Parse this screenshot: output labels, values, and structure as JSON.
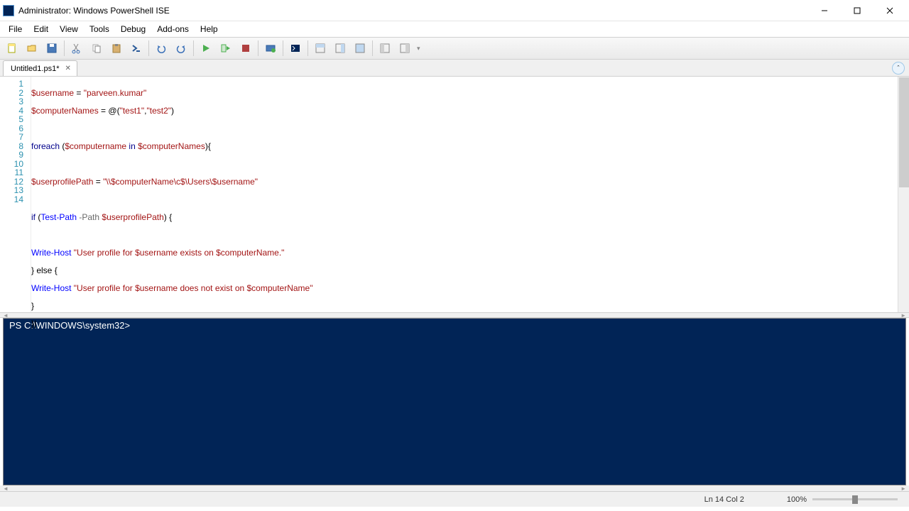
{
  "window": {
    "title": "Administrator: Windows PowerShell ISE"
  },
  "menu": {
    "file": "File",
    "edit": "Edit",
    "view": "View",
    "tools": "Tools",
    "debug": "Debug",
    "addons": "Add-ons",
    "help": "Help"
  },
  "tab": {
    "label": "Untitled1.ps1*"
  },
  "code_lines": {
    "l1_var": "$username",
    "l1_eq": " = ",
    "l1_str": "\"parveen.kumar\"",
    "l2_var": "$computerNames",
    "l2_eq": " = @(",
    "l2_s1": "\"test1\"",
    "l2_c": ",",
    "l2_s2": "\"test2\"",
    "l2_end": ")",
    "l4_kw": "foreach",
    "l4_o": " (",
    "l4_v1": "$computername",
    "l4_in": " in ",
    "l4_v2": "$computerNames",
    "l4_e": "){",
    "l6_v": "$userprofilePath",
    "l6_eq": " = ",
    "l6_s": "\"\\\\$computerName\\c$\\Users\\$username\"",
    "l8_if": "if",
    "l8_o": " (",
    "l8_cmd": "Test-Path",
    "l8_p": " -Path ",
    "l8_v": "$userprofilePath",
    "l8_e": ") {",
    "l10_cmd": "Write-Host",
    "l10_s": " \"User profile for $username exists on $computerName.\"",
    "l11": "} else {",
    "l12_cmd": "Write-Host",
    "l12_s": " \"User profile for $username does not exist on $computerName\"",
    "l13": "}",
    "l14": "}|"
  },
  "line_numbers": {
    "n1": "1",
    "n2": "2",
    "n3": "3",
    "n4": "4",
    "n5": "5",
    "n6": "6",
    "n7": "7",
    "n8": "8",
    "n9": "9",
    "n10": "10",
    "n11": "11",
    "n12": "12",
    "n13": "13",
    "n14": "14"
  },
  "console": {
    "prompt": "PS C:\\WINDOWS\\system32> "
  },
  "status": {
    "position": "Ln 14  Col 2",
    "zoom": "100%"
  }
}
